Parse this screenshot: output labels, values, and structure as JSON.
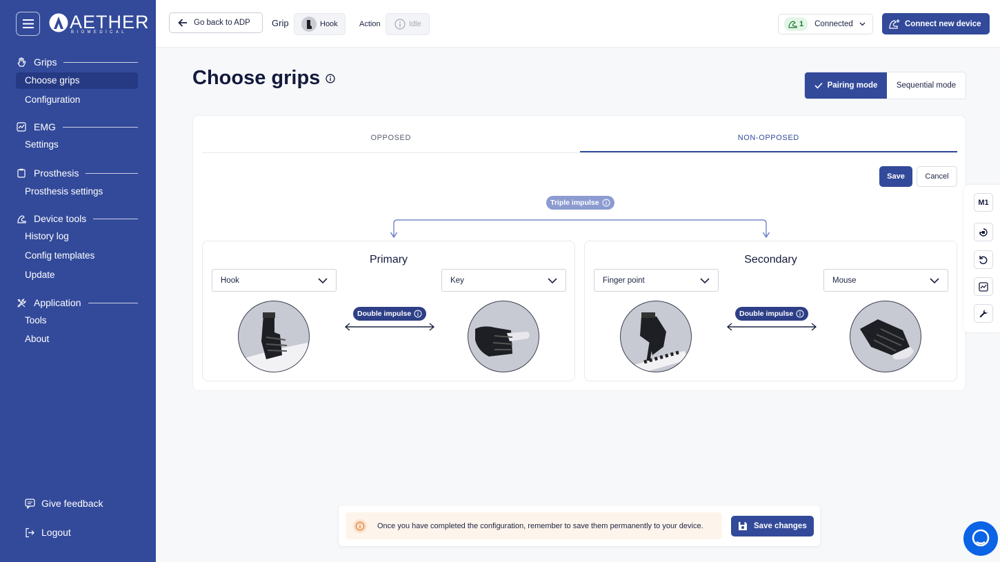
{
  "brand": {
    "name": "AETHER",
    "tagline": "BIOMEDICAL"
  },
  "sidebar": {
    "sections": [
      {
        "title": "Grips",
        "icon": "hand-icon",
        "items": [
          "Choose grips",
          "Configuration"
        ]
      },
      {
        "title": "EMG",
        "icon": "chart-icon",
        "items": [
          "Settings"
        ]
      },
      {
        "title": "Prosthesis",
        "icon": "clipboard-icon",
        "items": [
          "Prosthesis settings"
        ]
      },
      {
        "title": "Device tools",
        "icon": "arm-icon",
        "items": [
          "History log",
          "Config templates",
          "Update"
        ]
      },
      {
        "title": "Application",
        "icon": "tools-icon",
        "items": [
          "Tools",
          "About"
        ]
      }
    ],
    "active_item": "Choose grips",
    "feedback": "Give feedback",
    "logout": "Logout"
  },
  "topbar": {
    "back": "Go back to ADP",
    "grip_label": "Grip",
    "grip_value": "Hook",
    "action_label": "Action",
    "action_value": "Idle",
    "connection_count": "1",
    "connection_status": "Connected",
    "connect_new": "Connect new device"
  },
  "page": {
    "title": "Choose grips",
    "modes": {
      "active": "Pairing mode",
      "inactive": "Sequential mode"
    }
  },
  "tabs": [
    "OPPOSED",
    "NON-OPPOSED"
  ],
  "active_tab": "NON-OPPOSED",
  "actions": {
    "save": "Save",
    "cancel": "Cancel"
  },
  "triple_impulse": "Triple impulse",
  "primary": {
    "title": "Primary",
    "left": "Hook",
    "right": "Key",
    "link": "Double impulse"
  },
  "secondary": {
    "title": "Secondary",
    "left": "Finger point",
    "right": "Mouse",
    "link": "Double impulse"
  },
  "rail": {
    "m1": "M1"
  },
  "notice": {
    "text": "Once you have completed the configuration, remember to save them permanently to your device.",
    "button": "Save changes"
  },
  "colors": {
    "primary": "#334a9a",
    "sidebar": "#334a9a",
    "accent_light": "#8c9bd0"
  }
}
